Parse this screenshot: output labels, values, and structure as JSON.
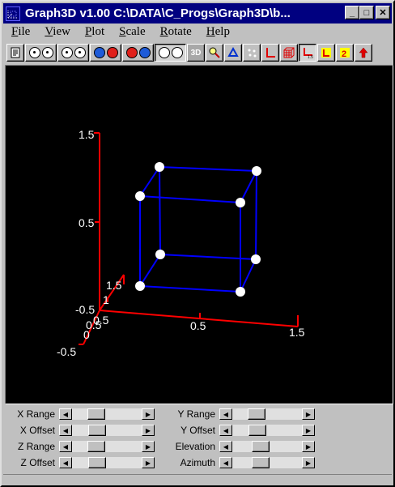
{
  "titlebar": {
    "title": "Graph3D v1.00  C:\\DATA\\C_Progs\\Graph3D\\b...",
    "minimize_label": "_",
    "maximize_label": "□",
    "close_label": "✕"
  },
  "menubar": {
    "items": [
      {
        "ul": "F",
        "rest": "ile"
      },
      {
        "ul": "V",
        "rest": "iew"
      },
      {
        "ul": "P",
        "rest": "lot"
      },
      {
        "ul": "S",
        "rest": "cale"
      },
      {
        "ul": "R",
        "rest": "otate"
      },
      {
        "ul": "H",
        "rest": "elp"
      }
    ]
  },
  "toolbar": {
    "button_3d_label": "3D"
  },
  "plot": {
    "z_ticks": [
      "1.5",
      "0.5"
    ],
    "x_ticks": [
      "0.5",
      "1.5"
    ],
    "y_axis_top_label": "1.5",
    "y_axis_top_label2": "1",
    "origin_labels": [
      "-0.5",
      "0.5",
      "0.5",
      "0",
      "-0.5"
    ],
    "colors": {
      "axes": "#ff0000",
      "edges": "#0000ff",
      "points": "#ffffff",
      "labels": "#ffffff"
    }
  },
  "controls": {
    "x_range": "X Range",
    "x_offset": "X Offset",
    "z_range": "Z Range",
    "z_offset": "Z Offset",
    "y_range": "Y Range",
    "y_offset": "Y Offset",
    "elevation": "Elevation",
    "azimuth": "Azimuth"
  },
  "sliders": {
    "x_range": 0.3,
    "x_offset": 0.32,
    "z_range": 0.3,
    "z_offset": 0.32,
    "y_range": 0.3,
    "y_offset": 0.32,
    "elevation": 0.38,
    "azimuth": 0.38
  }
}
